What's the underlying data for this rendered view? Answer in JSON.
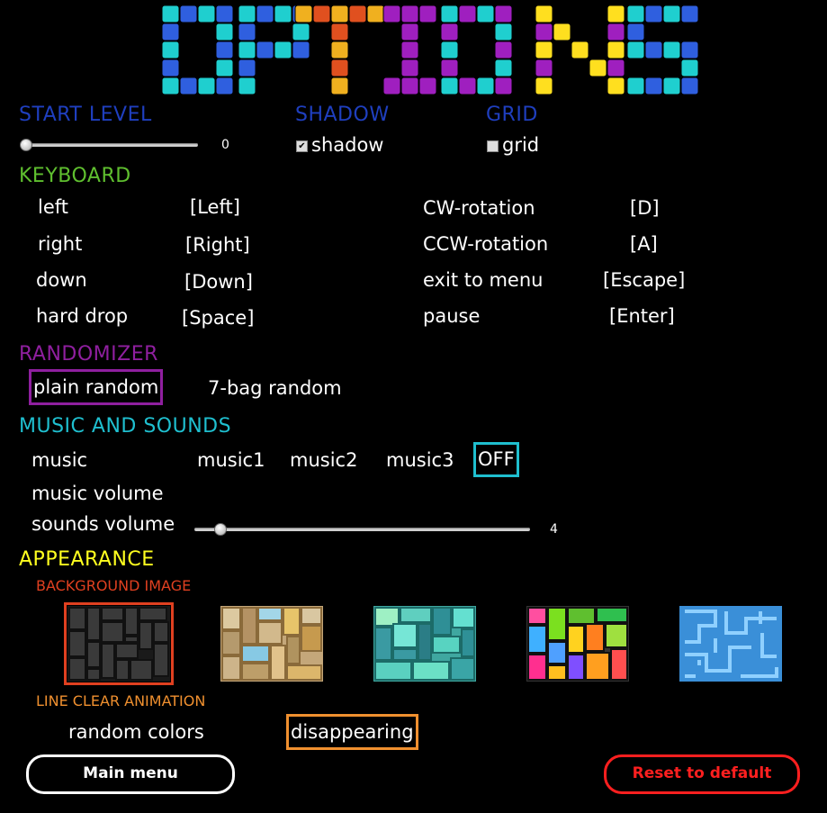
{
  "title_logo": "OPTIONS",
  "start_level": {
    "header": "START LEVEL",
    "value": "0",
    "level_fraction": 0.0
  },
  "shadow": {
    "header": "SHADOW",
    "label": "shadow",
    "checked": true
  },
  "grid": {
    "header": "GRID",
    "label": "grid",
    "checked": false
  },
  "keyboard": {
    "header": "KEYBOARD",
    "left_bindings": [
      {
        "action": "left",
        "key": "[Left]"
      },
      {
        "action": "right",
        "key": "[Right]"
      },
      {
        "action": "down",
        "key": "[Down]"
      },
      {
        "action": "hard drop",
        "key": "[Space]"
      }
    ],
    "right_bindings": [
      {
        "action": "CW-rotation",
        "key": "[D]"
      },
      {
        "action": "CCW-rotation",
        "key": "[A]"
      },
      {
        "action": "exit to menu",
        "key": "[Escape]"
      },
      {
        "action": "pause",
        "key": "[Enter]"
      }
    ]
  },
  "randomizer": {
    "header": "RANDOMIZER",
    "options": [
      "plain random",
      "7-bag random"
    ],
    "selected": "plain random"
  },
  "music_and_sounds": {
    "header": "MUSIC AND SOUNDS",
    "music_label": "music",
    "music_options": [
      "music1",
      "music2",
      "music3",
      "OFF"
    ],
    "music_selected": "OFF",
    "music_volume_label": "music volume",
    "sounds_volume_label": "sounds volume",
    "sounds_volume_value": "4",
    "sounds_volume_fraction": 0.06
  },
  "appearance": {
    "header": "APPEARANCE",
    "background_image_label": "BACKGROUND IMAGE",
    "background_thumbnails": [
      "dark-gray-blocks",
      "beige-blocks",
      "teal-blocks",
      "colorful-blocks",
      "blue-maze"
    ],
    "background_selected_index": 0,
    "line_clear_label": "LINE CLEAR ANIMATION",
    "line_clear_options": [
      "random colors",
      "disappearing"
    ],
    "line_clear_selected": "disappearing"
  },
  "buttons": {
    "main_menu": "Main menu",
    "reset": "Reset to default"
  },
  "colors": {
    "start_level": "#1f3fbf",
    "shadow": "#1f3fbf",
    "grid": "#1f3fbf",
    "keyboard": "#5fbf2f",
    "randomizer": "#8f1f9f",
    "music_and_sounds": "#1fbfcf",
    "appearance": "#ffff1f",
    "background_image": "#e04020",
    "line_clear": "#f0902f",
    "reset": "#ff1f1f"
  }
}
